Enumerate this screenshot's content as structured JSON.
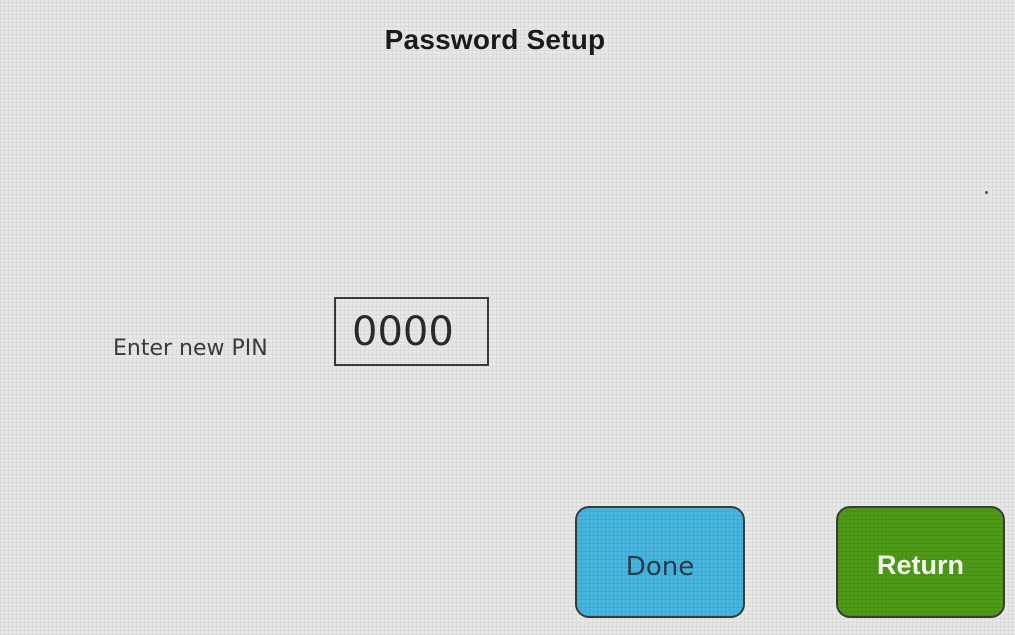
{
  "screen": {
    "title": "Password Setup"
  },
  "pin": {
    "label": "Enter new PIN",
    "value": "0000"
  },
  "buttons": {
    "done_label": "Done",
    "return_label": "Return"
  },
  "colors": {
    "background": "#e6e8e6",
    "done_button": "#47b5dd",
    "return_button": "#4e9a16"
  }
}
